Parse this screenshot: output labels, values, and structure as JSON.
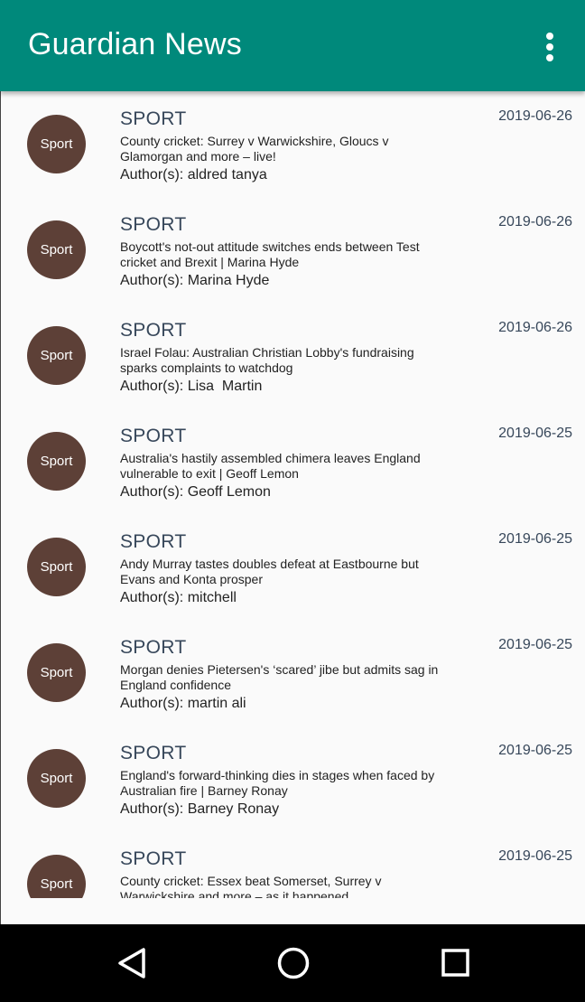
{
  "app": {
    "title": "Guardian News"
  },
  "articles": [
    {
      "avatar": "Sport",
      "section": "SPORT",
      "headline": "County cricket: Surrey v Warwickshire, Gloucs v Glamorgan and more – live!",
      "author": "Author(s): aldred tanya",
      "date": "2019-06-26"
    },
    {
      "avatar": "Sport",
      "section": "SPORT",
      "headline": "Boycott's not-out attitude switches ends between Test cricket and Brexit | Marina Hyde",
      "author": "Author(s): Marina Hyde",
      "date": "2019-06-26"
    },
    {
      "avatar": "Sport",
      "section": "SPORT",
      "headline": "Israel Folau: Australian Christian Lobby's fundraising sparks complaints to watchdog",
      "author": "Author(s): Lisa  Martin",
      "date": "2019-06-26"
    },
    {
      "avatar": "Sport",
      "section": "SPORT",
      "headline": "Australia's hastily assembled chimera leaves England vulnerable to exit | Geoff Lemon",
      "author": "Author(s): Geoff Lemon",
      "date": "2019-06-25"
    },
    {
      "avatar": "Sport",
      "section": "SPORT",
      "headline": "Andy Murray tastes doubles defeat at Eastbourne but Evans and Konta prosper",
      "author": "Author(s): mitchell",
      "date": "2019-06-25"
    },
    {
      "avatar": "Sport",
      "section": "SPORT",
      "headline": "Morgan denies Pietersen's ‘scared’ jibe but admits sag in England confidence",
      "author": "Author(s): martin ali",
      "date": "2019-06-25"
    },
    {
      "avatar": "Sport",
      "section": "SPORT",
      "headline": "England's forward-thinking dies in stages when faced by Australian fire | Barney Ronay",
      "author": "Author(s): Barney Ronay",
      "date": "2019-06-25"
    },
    {
      "avatar": "Sport",
      "section": "SPORT",
      "headline": "County cricket: Essex beat Somerset, Surrey v Warwickshire and more – as it happened",
      "author": "",
      "date": "2019-06-25"
    }
  ],
  "icons": {
    "overflow": "more-vert-icon",
    "back": "back-icon",
    "home": "home-icon",
    "recents": "recents-icon"
  },
  "colors": {
    "appbar": "#00897b",
    "avatar": "#5d4037",
    "navbar": "#000000"
  }
}
